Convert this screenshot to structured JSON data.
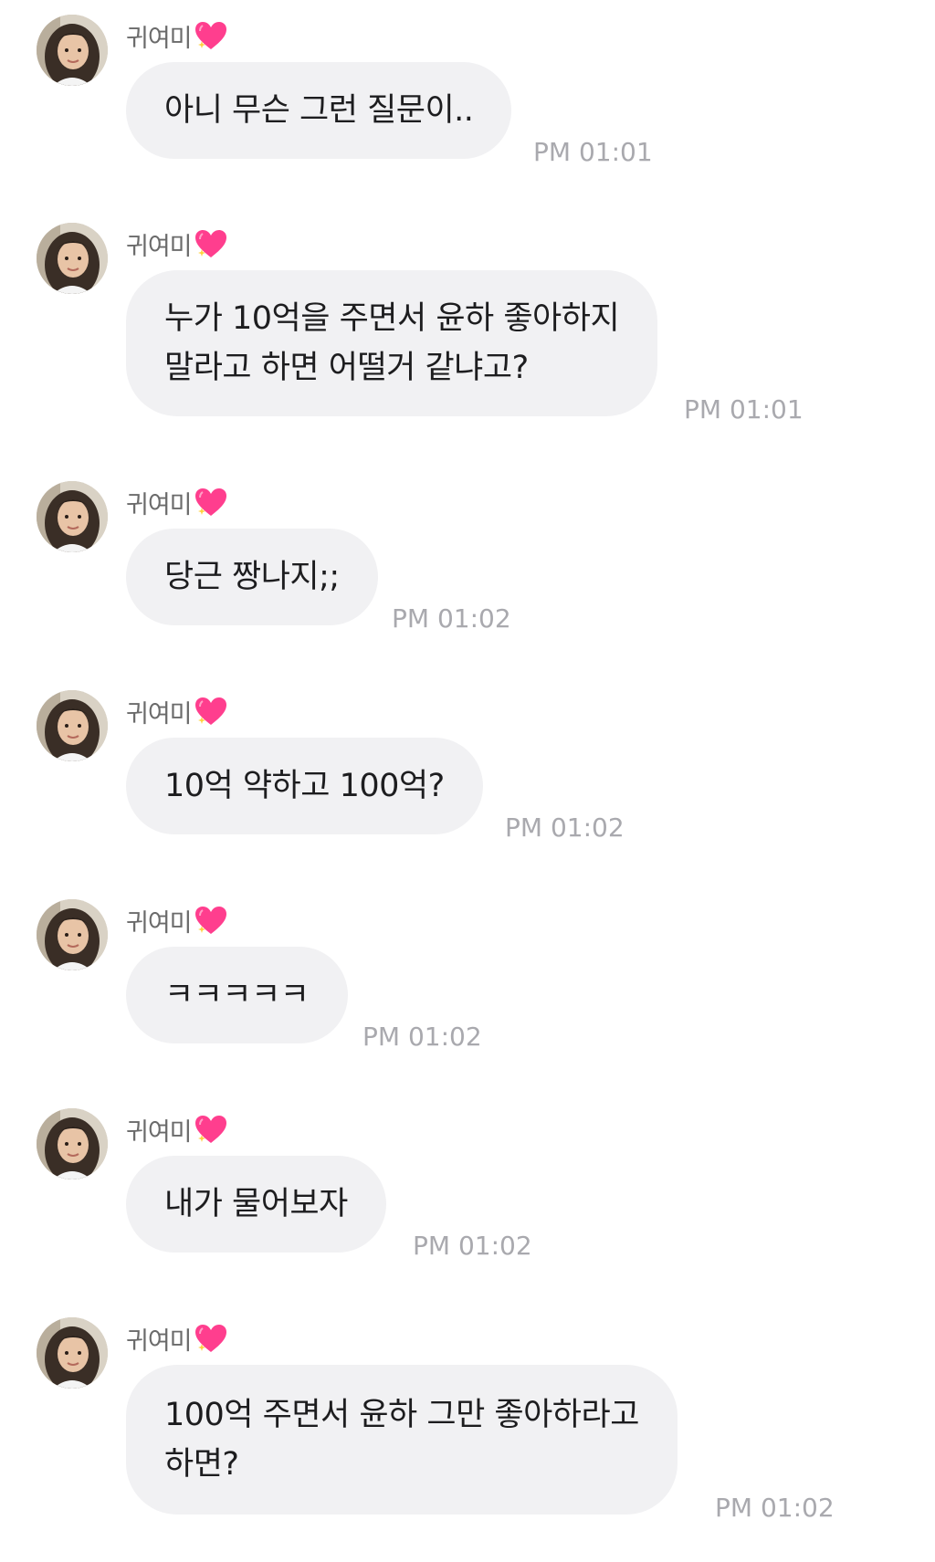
{
  "sender": {
    "name": "귀여미",
    "badge_icon": "sparkling-heart-icon"
  },
  "messages": [
    {
      "text": "아니 무슨 그런 질문이..",
      "time": "PM 01:01"
    },
    {
      "text": "누가 10억을 주면서 윤하 좋아하지\n말라고 하면 어떨거 같냐고?",
      "time": "PM 01:01"
    },
    {
      "text": "당근 짱나지;;",
      "time": "PM 01:02"
    },
    {
      "text": "10억 약하고 100억?",
      "time": "PM 01:02"
    },
    {
      "text": "ㅋㅋㅋㅋㅋ",
      "time": "PM 01:02"
    },
    {
      "text": "내가 물어보자",
      "time": "PM 01:02"
    },
    {
      "text": "100억 주면서 윤하 그만 좋아하라고\n하면?",
      "time": "PM 01:02"
    }
  ],
  "colors": {
    "bubble": "#f1f1f3",
    "text": "#1d1d1f",
    "time": "#a9a9ae",
    "sender": "#6b6b6b",
    "heart": "#ff3e8e"
  }
}
